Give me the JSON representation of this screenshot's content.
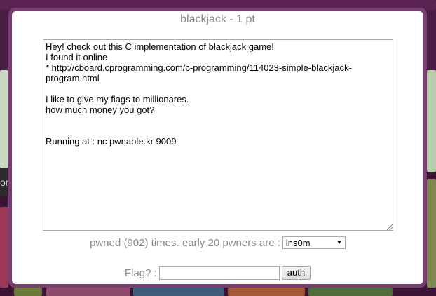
{
  "background": {
    "left_text": "or"
  },
  "challenge": {
    "title": "blackjack - 1 pt",
    "description": "Hey! check out this C implementation of blackjack game!\nI found it online\n* http://cboard.cprogramming.com/c-programming/114023-simple-blackjack-program.html\n\nI like to give my flags to millionares.\nhow much money you got?\n\n\nRunning at : nc pwnable.kr 9009"
  },
  "pwned": {
    "text": "pwned (902) times. early 20 pwners are :",
    "selected_pwner": "ins0m"
  },
  "flag": {
    "label": "Flag? :",
    "value": "",
    "button_label": "auth"
  },
  "colors": {
    "modal_border": "#7a3d73",
    "page_background": "#3b1434",
    "muted_text": "#8a8a8a"
  },
  "icons": [
    "chevron-down-icon",
    "resize-grip-icon"
  ]
}
